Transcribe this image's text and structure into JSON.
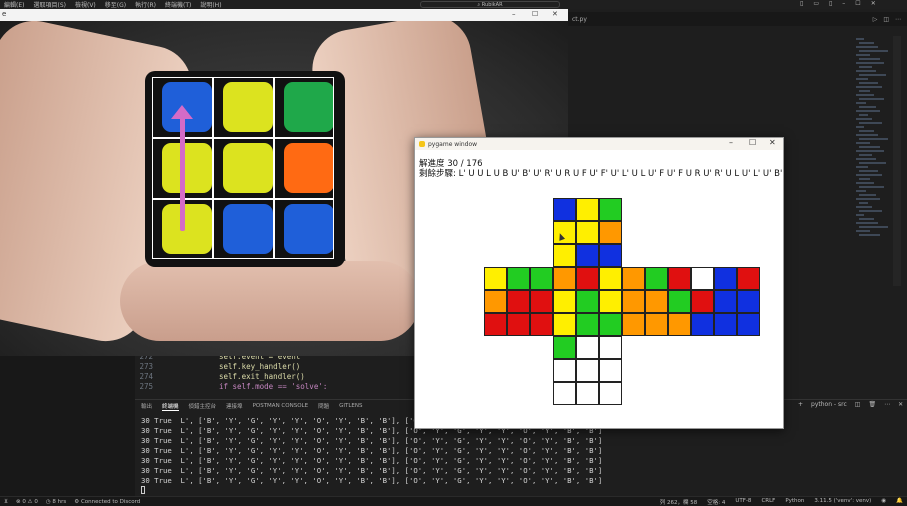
{
  "menubar": {
    "items": [
      "編輯(E)",
      "選取項目(S)",
      "檢視(V)",
      "移至(G)",
      "執行(R)",
      "終端機(T)",
      "說明(H)"
    ],
    "search": "RubikAR"
  },
  "editor": {
    "tab_label": "ct.py",
    "code_lines": [
      {
        "num": "272",
        "text": "self.event = event"
      },
      {
        "num": "273",
        "text": "self.key_handler()"
      },
      {
        "num": "274",
        "text": "self.exit_handler()"
      },
      {
        "num": "275",
        "text": "if self.mode == 'solve':"
      }
    ]
  },
  "video": {
    "window_title": "e",
    "cube_faces": [
      [
        "#1f5fd9",
        "#dce31f",
        "#1fa84a"
      ],
      [
        "#dce31f",
        "#dce31f",
        "#ff6a13"
      ],
      [
        "#dce31f",
        "#1f5fd9",
        "#1f5fd9"
      ]
    ]
  },
  "pygame": {
    "window_title": "pygame window",
    "progress_text": "解進度 30 / 176",
    "steps_text": "剩餘步驟: L' U U L U B U' B' U' R' U R U F U' F' U' L' U L U' F U' F U R U' R' U L U' L' U' B' U B B U' B",
    "colors": {
      "W": "#ffffff",
      "Y": "#ffef00",
      "R": "#e01010",
      "O": "#ff9800",
      "G": "#22cc22",
      "B": "#1030e0"
    },
    "faces": {
      "U": [
        [
          "B",
          "Y",
          "G"
        ],
        [
          "Y",
          "Y",
          "O"
        ],
        [
          "Y",
          "B",
          "B"
        ]
      ],
      "L": [
        [
          "Y",
          "G",
          "G"
        ],
        [
          "O",
          "R",
          "R"
        ],
        [
          "R",
          "R",
          "R"
        ]
      ],
      "F": [
        [
          "O",
          "R",
          "Y"
        ],
        [
          "Y",
          "G",
          "Y"
        ],
        [
          "Y",
          "G",
          "G"
        ]
      ],
      "R": [
        [
          "O",
          "G",
          "R"
        ],
        [
          "O",
          "O",
          "G"
        ],
        [
          "O",
          "O",
          "O"
        ]
      ],
      "Bk": [
        [
          "W",
          "B",
          "R"
        ],
        [
          "R",
          "B",
          "B"
        ],
        [
          "B",
          "B",
          "B"
        ]
      ],
      "D": [
        [
          "G",
          "W",
          "W"
        ],
        [
          "W",
          "W",
          "W"
        ],
        [
          "W",
          "W",
          "W"
        ]
      ]
    }
  },
  "panel": {
    "tabs": [
      "輸出",
      "終端機",
      "偵錯主控台",
      "連接埠",
      "POSTMAN CONSOLE",
      "問題",
      "GITLENS"
    ],
    "active_tab": "終端機",
    "shell_label": "python - src",
    "terminal_lines": [
      "30 True  L', ['B', 'Y', 'G', 'Y', 'Y', 'O', 'Y', 'B', 'B'], ['O', 'Y', 'G', 'Y', 'Y', 'O', 'Y', 'B', 'B']",
      "30 True  L', ['B', 'Y', 'G', 'Y', 'Y', 'O', 'Y', 'B', 'B'], ['O', 'Y', 'G', 'Y', 'Y', 'O', 'Y', 'B', 'B']",
      "30 True  L', ['B', 'Y', 'G', 'Y', 'Y', 'O', 'Y', 'B', 'B'], ['O', 'Y', 'G', 'Y', 'Y', 'O', 'Y', 'B', 'B']",
      "30 True  L', ['B', 'Y', 'G', 'Y', 'Y', 'O', 'Y', 'B', 'B'], ['O', 'Y', 'G', 'Y', 'Y', 'O', 'Y', 'B', 'B']",
      "30 True  L', ['B', 'Y', 'G', 'Y', 'Y', 'O', 'Y', 'B', 'B'], ['O', 'Y', 'G', 'Y', 'Y', 'O', 'Y', 'B', 'B']",
      "30 True  L', ['B', 'Y', 'G', 'Y', 'Y', 'O', 'Y', 'B', 'B'], ['O', 'Y', 'G', 'Y', 'Y', 'O', 'Y', 'B', 'B']",
      "30 True  L', ['B', 'Y', 'G', 'Y', 'Y', 'O', 'Y', 'B', 'B'], ['O', 'Y', 'G', 'Y', 'Y', 'O', 'Y', 'B', 'B']"
    ]
  },
  "statusbar": {
    "errors": "0",
    "warnings": "0",
    "hrs": "8 hrs",
    "discord": "Connected to Discord",
    "position": "列 262，欄 58",
    "spaces": "空格: 4",
    "encoding": "UTF-8",
    "eol": "CRLF",
    "language": "Python",
    "interpreter": "3.11.5 ('venv': venv)"
  }
}
